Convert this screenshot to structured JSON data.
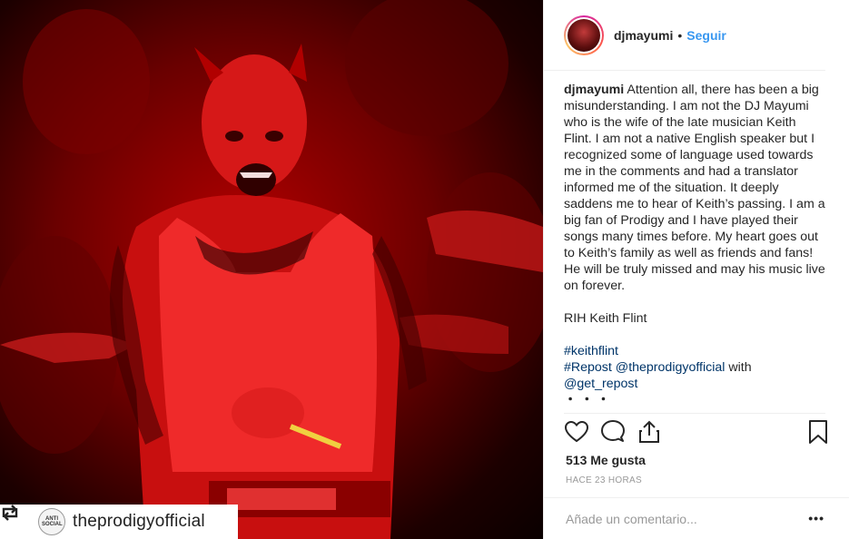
{
  "post": {
    "username": "djmayumi",
    "follow_label": "Seguir",
    "caption_user": "djmayumi",
    "caption_lines": [
      "Attention all, there has been a big misunderstanding. I am not the DJ Mayumi who is the wife of the late musician Keith Flint. I am not a native English speaker but I recognized some of language used towards me in the comments and had a translator informed me of the situation. It deeply saddens me to hear of Keith’s passing. I am a big fan of Prodigy and I have played their songs many times before. My heart goes out to Keith’s family as well as friends and fans! He will be truly missed and may his music live on forever."
    ],
    "caption_rih": "RIH Keith Flint",
    "hashtag": "#keithflint",
    "repost_tag": "#Repost",
    "repost_mention": "@theprodigyofficial",
    "repost_with": "with",
    "get_repost": "@get_repost",
    "more_dots": "・・・",
    "likes": "513 Me gusta",
    "time": "HACE 23 HORAS",
    "comment_placeholder": "Añade un comentario...",
    "more_options": "•••"
  },
  "repost_overlay": {
    "username": "theprodigyofficial",
    "avatar_text": "ANTI SOCIAL"
  },
  "colors": {
    "link_blue": "#3897f0",
    "hashtag_navy": "#003569",
    "photo_red": "#b30000"
  }
}
